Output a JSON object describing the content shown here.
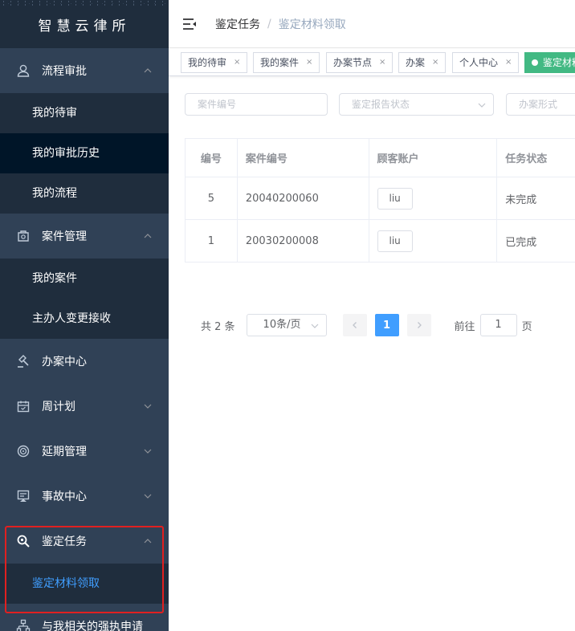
{
  "app": {
    "title": "智慧云律所"
  },
  "sidebar": {
    "groups": [
      {
        "label": "流程审批",
        "icon": "user-icon",
        "expanded": true,
        "children": [
          {
            "label": "我的待审"
          },
          {
            "label": "我的审批历史"
          },
          {
            "label": "我的流程"
          }
        ]
      },
      {
        "label": "案件管理",
        "icon": "case-icon",
        "expanded": true,
        "children": [
          {
            "label": "我的案件"
          },
          {
            "label": "主办人变更接收"
          }
        ]
      },
      {
        "label": "办案中心",
        "icon": "gavel-icon"
      },
      {
        "label": "周计划",
        "icon": "calendar-icon"
      },
      {
        "label": "延期管理",
        "icon": "target-icon"
      },
      {
        "label": "事故中心",
        "icon": "alert-icon"
      },
      {
        "label": "鉴定任务",
        "icon": "search-icon",
        "expanded": true,
        "children": [
          {
            "label": "鉴定材料领取"
          }
        ]
      },
      {
        "label": "与我相关的强执申请",
        "icon": "org-icon"
      }
    ]
  },
  "navbar": {
    "breadcrumb": [
      "鉴定任务",
      "鉴定材料领取"
    ],
    "separator": "/"
  },
  "tags": [
    {
      "label": "我的待审",
      "close": "×"
    },
    {
      "label": "我的案件",
      "close": "×"
    },
    {
      "label": "办案节点",
      "close": "×"
    },
    {
      "label": "办案",
      "close": "×"
    },
    {
      "label": "个人中心",
      "close": "×"
    },
    {
      "label": "鉴定材料领取",
      "active": true
    }
  ],
  "filters": {
    "case_no_placeholder": "案件编号",
    "report_status_placeholder": "鉴定报告状态",
    "handling_form_placeholder": "办案形式"
  },
  "table": {
    "headers": [
      "编号",
      "案件编号",
      "顾客账户",
      "任务状态"
    ],
    "rows": [
      {
        "id": "5",
        "case_no": "20040200060",
        "account": "liu",
        "status": "未完成"
      },
      {
        "id": "1",
        "case_no": "20030200008",
        "account": "liu",
        "status": "已完成"
      }
    ]
  },
  "pagination": {
    "total": "共 2 条",
    "page_size": "10条/页",
    "current": "1",
    "goto_prefix": "前往",
    "goto_value": "1",
    "goto_suffix": "页"
  },
  "colors": {
    "sidebar_bg": "#304156",
    "submenu_bg": "#1f2d3d",
    "active_text": "#409eff",
    "active_tag": "#42b983",
    "highlight_border": "#e02020"
  }
}
